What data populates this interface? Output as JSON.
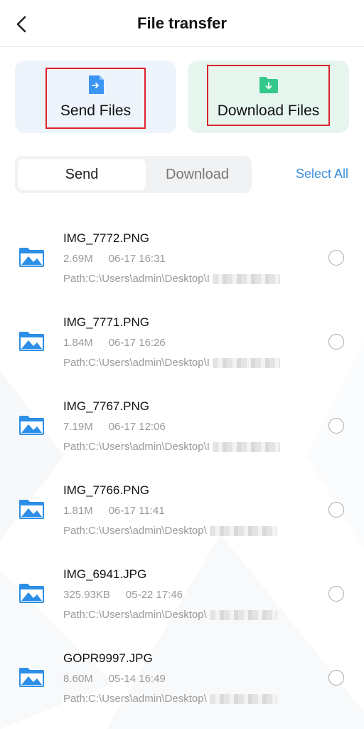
{
  "header": {
    "title": "File transfer",
    "back_icon": "chevron-left-icon"
  },
  "cards": {
    "send": {
      "label": "Send Files",
      "icon": "file-send-icon",
      "color": "#3b96f3"
    },
    "download": {
      "label": "Download Files",
      "icon": "folder-download-icon",
      "color": "#34c98a"
    }
  },
  "tabs": {
    "send": "Send",
    "download": "Download",
    "active": "Send"
  },
  "select_all": "Select All",
  "files": [
    {
      "name": "IMG_7772.PNG",
      "size": "2.69M",
      "date": "06-17 16:31",
      "path": "Path:C:\\Users\\admin\\Desktop\\I",
      "selected": false
    },
    {
      "name": "IMG_7771.PNG",
      "size": "1.84M",
      "date": "06-17 16:26",
      "path": "Path:C:\\Users\\admin\\Desktop\\I",
      "selected": false
    },
    {
      "name": "IMG_7767.PNG",
      "size": "7.19M",
      "date": "06-17 12:06",
      "path": "Path:C:\\Users\\admin\\Desktop\\I",
      "selected": false
    },
    {
      "name": "IMG_7766.PNG",
      "size": "1.81M",
      "date": "06-17 11:41",
      "path": "Path:C:\\Users\\admin\\Desktop\\",
      "selected": false
    },
    {
      "name": "IMG_6941.JPG",
      "size": "325.93KB",
      "date": "05-22 17:46",
      "path": "Path:C:\\Users\\admin\\Desktop\\",
      "selected": false
    },
    {
      "name": "GOPR9997.JPG",
      "size": "8.60M",
      "date": "05-14 16:49",
      "path": "Path:C:\\Users\\admin\\Desktop\\",
      "selected": false
    }
  ],
  "colors": {
    "accent": "#3a8fd9",
    "highlight": "#d8262a",
    "file_icon": "#2c8ee6"
  }
}
